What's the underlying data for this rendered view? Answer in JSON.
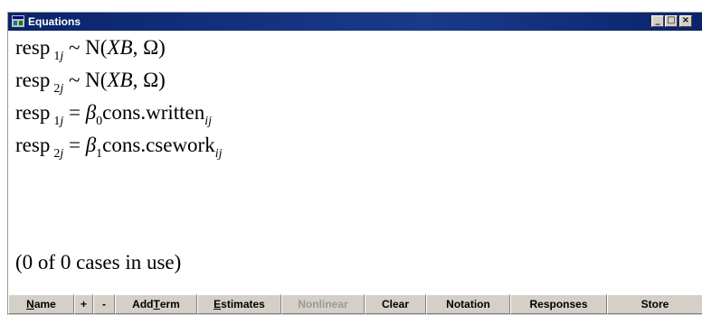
{
  "window": {
    "title": "Equations",
    "controls": {
      "minimize": "_",
      "maximize": "□",
      "close": "×"
    }
  },
  "equations": [
    {
      "lhs": "resp",
      "lhs_sub": "1j",
      "op": "~",
      "rhs": "N(XB, Ω)"
    },
    {
      "lhs": "resp",
      "lhs_sub": "2j",
      "op": "~",
      "rhs": "N(XB, Ω)"
    },
    {
      "lhs": "resp",
      "lhs_sub": "1j",
      "op": "=",
      "coef": "β",
      "coef_sub": "0",
      "term": "cons.written",
      "term_sub": "ij"
    },
    {
      "lhs": "resp",
      "lhs_sub": "2j",
      "op": "=",
      "coef": "β",
      "coef_sub": "1",
      "term": "cons.csework",
      "term_sub": "ij"
    }
  ],
  "status": "(0 of 0 cases in use)",
  "toolbar": {
    "buttons": [
      {
        "pre": "",
        "u": "N",
        "post": "ame",
        "disabled": false
      },
      {
        "pre": "+",
        "u": "",
        "post": "",
        "disabled": false
      },
      {
        "pre": "-",
        "u": "",
        "post": "",
        "disabled": false
      },
      {
        "pre": "Add ",
        "u": "T",
        "post": "erm",
        "disabled": false
      },
      {
        "pre": "",
        "u": "E",
        "post": "stimates",
        "disabled": false
      },
      {
        "pre": "Nonlinear",
        "u": "",
        "post": "",
        "disabled": true
      },
      {
        "pre": "Clear",
        "u": "",
        "post": "",
        "disabled": false
      },
      {
        "pre": "Notation",
        "u": "",
        "post": "",
        "disabled": false
      },
      {
        "pre": "Responses",
        "u": "",
        "post": "",
        "disabled": false
      },
      {
        "pre": "Store",
        "u": "",
        "post": "",
        "disabled": false
      }
    ]
  }
}
